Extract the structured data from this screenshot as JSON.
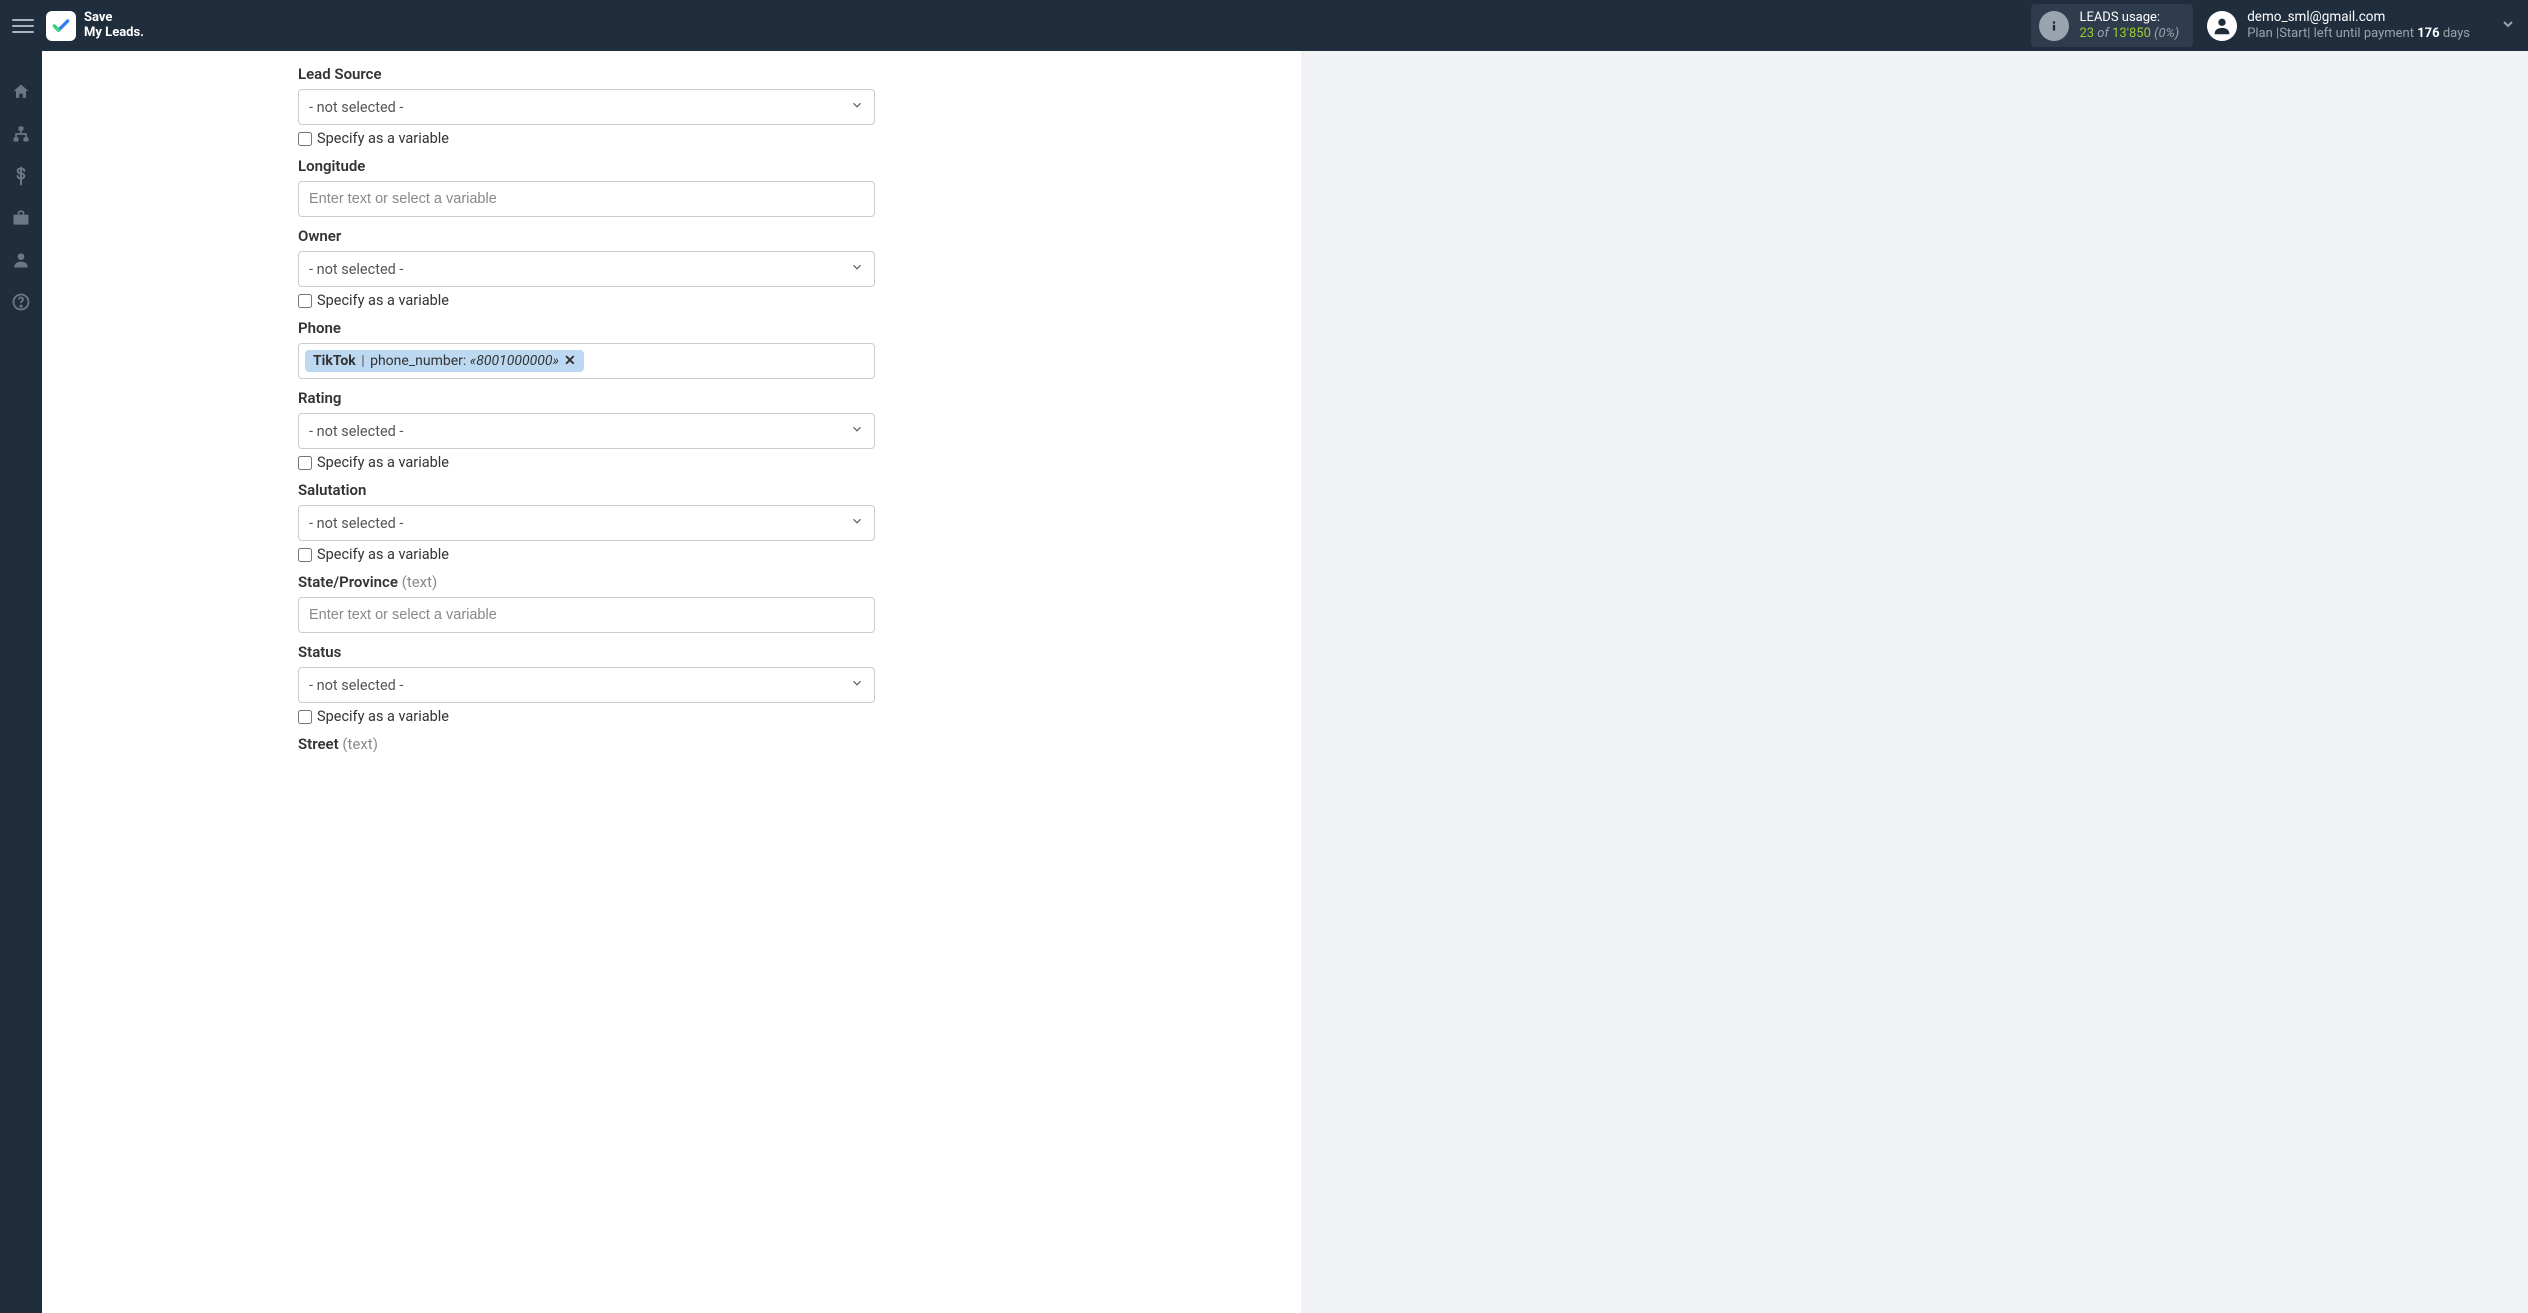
{
  "brand": {
    "line1": "Save",
    "line2": "My Leads."
  },
  "usage": {
    "title": "LEADS usage:",
    "count": "23",
    "of": "of",
    "limit": "13'850",
    "percent": "(0%)"
  },
  "user": {
    "email": "demo_sml@gmail.com",
    "plan_label": "Plan |Start| left until payment",
    "days_count": "176",
    "days_word": "days"
  },
  "placeholders": {
    "text_or_var": "Enter text or select a variable",
    "not_selected": "- not selected -"
  },
  "checkbox_label": "Specify as a variable",
  "fields": {
    "lead_source": {
      "label": "Lead Source"
    },
    "longitude": {
      "label": "Longitude"
    },
    "owner": {
      "label": "Owner"
    },
    "phone": {
      "label": "Phone",
      "token_source": "TikTok",
      "token_key": "phone_number:",
      "token_value": "«8001000000»"
    },
    "rating": {
      "label": "Rating"
    },
    "salutation": {
      "label": "Salutation"
    },
    "state_province": {
      "label": "State/Province",
      "hint": "(text)"
    },
    "status": {
      "label": "Status"
    },
    "street": {
      "label": "Street",
      "hint": "(text)"
    }
  }
}
